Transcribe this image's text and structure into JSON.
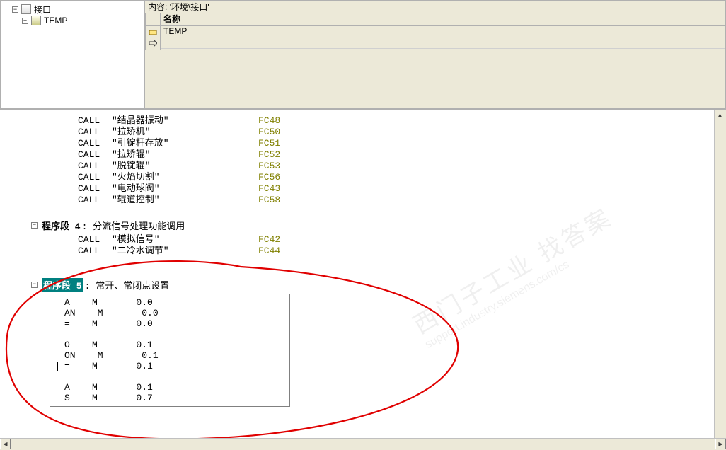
{
  "header": {
    "content_label": "内容:",
    "content_path": "'环境\\接口'"
  },
  "tree": {
    "root": {
      "label": "接口",
      "expander": "−"
    },
    "child": {
      "label": "TEMP",
      "expander": "+"
    }
  },
  "grid": {
    "name_header": "名称",
    "rows": [
      {
        "name": "TEMP"
      }
    ]
  },
  "code": {
    "calls_block1": [
      {
        "op": "CALL",
        "arg": "\"结晶器振动\"",
        "fc": "FC48"
      },
      {
        "op": "CALL",
        "arg": "\"拉矫机\"",
        "fc": "FC50"
      },
      {
        "op": "CALL",
        "arg": "\"引锭杆存放\"",
        "fc": "FC51"
      },
      {
        "op": "CALL",
        "arg": "\"拉矫辊\"",
        "fc": "FC52"
      },
      {
        "op": "CALL",
        "arg": "\"脱锭辊\"",
        "fc": "FC53"
      },
      {
        "op": "CALL",
        "arg": "\"火焰切割\"",
        "fc": "FC56"
      },
      {
        "op": "CALL",
        "arg": "\"电动球阀\"",
        "fc": "FC43"
      },
      {
        "op": "CALL",
        "arg": "\"辊道控制\"",
        "fc": "FC58"
      }
    ],
    "segment4": {
      "expander": "−",
      "title": "程序段  4",
      "subtitle": ": 分流信号处理功能调用",
      "calls": [
        {
          "op": "CALL",
          "arg": "\"模拟信号\"",
          "fc": "FC42"
        },
        {
          "op": "CALL",
          "arg": "\"二冷水调节\"",
          "fc": "FC44"
        }
      ]
    },
    "segment5": {
      "expander": "−",
      "title": "程序段  5",
      "subtitle": ": 常开、常闭点设置",
      "stl": [
        {
          "op": "A",
          "adr": "M",
          "val": "0.0"
        },
        {
          "op": "AN",
          "adr": "M",
          "val": "0.0"
        },
        {
          "op": "=",
          "adr": "M",
          "val": "0.0"
        },
        {
          "blank": true
        },
        {
          "op": "O",
          "adr": "M",
          "val": "0.1"
        },
        {
          "op": "ON",
          "adr": "M",
          "val": "0.1"
        },
        {
          "op": "=",
          "adr": "M",
          "val": "0.1",
          "cursor": true
        },
        {
          "blank": true
        },
        {
          "op": "A",
          "adr": "M",
          "val": "0.1"
        },
        {
          "op": "S",
          "adr": "M",
          "val": "0.7"
        }
      ]
    }
  },
  "watermark": {
    "line1": "西门子工业  找答案",
    "line2": "support.industry.siemens.com/cs"
  }
}
